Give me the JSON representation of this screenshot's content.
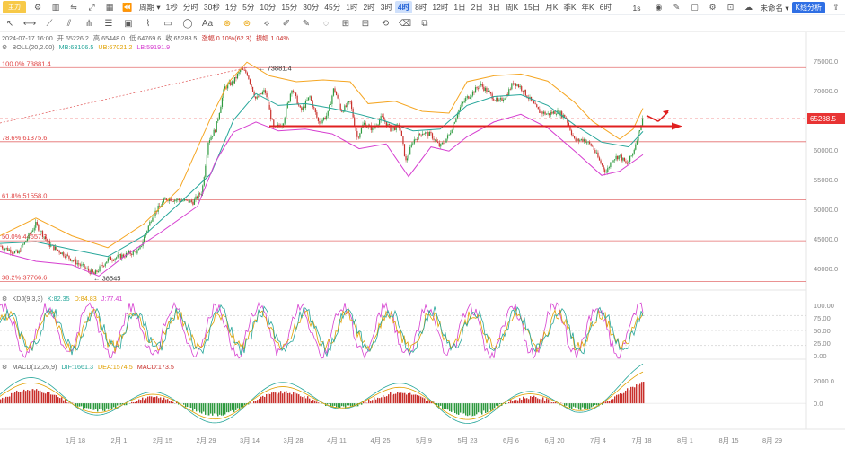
{
  "toolbar": {
    "badge": "主力",
    "period_label": "周期",
    "intervals": [
      "1秒",
      "分时",
      "30秒",
      "1分",
      "5分",
      "10分",
      "15分",
      "30分",
      "45分",
      "1时",
      "2时",
      "3时",
      "4时",
      "8时",
      "12时",
      "1日",
      "2日",
      "3日",
      "周K",
      "15日",
      "月K",
      "季K",
      "年K",
      "6时"
    ],
    "active_interval": "4时",
    "right_value": "1s",
    "template_label": "未命名",
    "kline_button": "K线分析"
  },
  "info": {
    "date": "2024-07-17 16:00",
    "open": "开 65226.2",
    "high": "高 65448.0",
    "low": "低 64769.6",
    "close": "收 65288.5",
    "change": "涨幅 0.10%(62.3)",
    "amplitude": "振幅 1.04%",
    "boll_label": "BOLL(20,2.00)",
    "boll_mb": "MB:63106.5",
    "boll_ub": "UB:67021.2",
    "boll_lb": "LB:59191.9",
    "kdj_label": "KDJ(9,3,3)",
    "kdj_k": "K:82.35",
    "kdj_d": "D:84.83",
    "kdj_j": "J:77.41",
    "macd_label": "MACD(12,26,9)",
    "macd_dif": "DIF:1661.3",
    "macd_dea": "DEA:1574.5",
    "macd_val": "MACD:173.5"
  },
  "fib_levels": [
    {
      "label": "100.0% 73881.4",
      "value": 73881.4
    },
    {
      "label": "78.6% 61375.6",
      "value": 61375.6
    },
    {
      "label": "61.8% 51558.0",
      "value": 51558.0
    },
    {
      "label": "50.0% 44657.3",
      "value": 44657.3
    },
    {
      "label": "38.2% 37766.6",
      "value": 37766.6
    }
  ],
  "annotations": {
    "high_label": "73881.4",
    "low_label": "38545",
    "current_price": "65288.5"
  },
  "colors": {
    "up": "#2e9a3f",
    "down": "#c9302c",
    "boll_mb": "#26a69a",
    "boll_ub": "#f5a623",
    "boll_lb": "#d63fd0",
    "fib": "#e05555",
    "arrow": "#e02020",
    "price_tag": "#e83333",
    "kdj_k": "#26a69a",
    "kdj_d": "#e0a000",
    "kdj_j": "#d63fd0",
    "macd_dif": "#26a69a",
    "macd_dea": "#e0a000"
  },
  "chart_data": {
    "type": "candlestick",
    "price_axis": [
      "75000.0",
      "70000.0",
      "65000.0",
      "60000.0",
      "55000.0",
      "50000.0",
      "45000.0",
      "40000.0"
    ],
    "price_ylim": [
      36500,
      76500
    ],
    "kdj_axis": [
      "100.00",
      "75.00",
      "50.00",
      "25.00",
      "0.00"
    ],
    "macd_axis": [
      "2000.0",
      "0.0"
    ],
    "x_labels": [
      "1月 18",
      "2月 1",
      "2月 15",
      "2月 29",
      "3月 14",
      "3月 28",
      "4月 11",
      "4月 25",
      "5月 9",
      "5月 23",
      "6月 6",
      "6月 20",
      "7月 4",
      "7月 18",
      "8月 1",
      "8月 15",
      "8月 29"
    ],
    "close_path": [
      [
        0,
        43800
      ],
      [
        20,
        42500
      ],
      [
        40,
        47500
      ],
      [
        55,
        44000
      ],
      [
        70,
        42500
      ],
      [
        90,
        40500
      ],
      [
        105,
        39000
      ],
      [
        120,
        41500
      ],
      [
        140,
        42300
      ],
      [
        155,
        43000
      ],
      [
        170,
        49000
      ],
      [
        185,
        51800
      ],
      [
        200,
        51500
      ],
      [
        215,
        51200
      ],
      [
        225,
        53000
      ],
      [
        232,
        61500
      ],
      [
        240,
        63500
      ],
      [
        250,
        70500
      ],
      [
        260,
        71500
      ],
      [
        268,
        73500
      ],
      [
        275,
        73000
      ],
      [
        285,
        68500
      ],
      [
        295,
        70000
      ],
      [
        305,
        63500
      ],
      [
        315,
        64500
      ],
      [
        325,
        70500
      ],
      [
        335,
        66500
      ],
      [
        345,
        69000
      ],
      [
        355,
        64500
      ],
      [
        365,
        66000
      ],
      [
        372,
        70500
      ],
      [
        380,
        66500
      ],
      [
        390,
        68000
      ],
      [
        398,
        62000
      ],
      [
        405,
        64500
      ],
      [
        415,
        63500
      ],
      [
        425,
        65500
      ],
      [
        435,
        63500
      ],
      [
        445,
        64000
      ],
      [
        452,
        58000
      ],
      [
        460,
        61500
      ],
      [
        470,
        63000
      ],
      [
        480,
        62500
      ],
      [
        490,
        60500
      ],
      [
        500,
        62500
      ],
      [
        510,
        66500
      ],
      [
        518,
        68500
      ],
      [
        525,
        69500
      ],
      [
        535,
        71000
      ],
      [
        545,
        69500
      ],
      [
        555,
        68000
      ],
      [
        565,
        69500
      ],
      [
        572,
        71500
      ],
      [
        580,
        70500
      ],
      [
        590,
        68500
      ],
      [
        600,
        66500
      ],
      [
        610,
        66000
      ],
      [
        620,
        66500
      ],
      [
        630,
        65500
      ],
      [
        640,
        61500
      ],
      [
        650,
        61800
      ],
      [
        660,
        60500
      ],
      [
        668,
        58000
      ],
      [
        675,
        56200
      ],
      [
        682,
        58500
      ],
      [
        690,
        59000
      ],
      [
        698,
        57500
      ],
      [
        705,
        59500
      ],
      [
        712,
        63500
      ],
      [
        716,
        65288
      ]
    ],
    "bollinger": {
      "mb": [
        [
          0,
          44200
        ],
        [
          40,
          44500
        ],
        [
          80,
          43200
        ],
        [
          120,
          42000
        ],
        [
          160,
          45500
        ],
        [
          200,
          51000
        ],
        [
          235,
          56000
        ],
        [
          260,
          65000
        ],
        [
          285,
          69500
        ],
        [
          310,
          67500
        ],
        [
          340,
          67800
        ],
        [
          370,
          67000
        ],
        [
          400,
          66000
        ],
        [
          430,
          64800
        ],
        [
          460,
          63200
        ],
        [
          490,
          63500
        ],
        [
          520,
          67500
        ],
        [
          550,
          69000
        ],
        [
          580,
          69300
        ],
        [
          610,
          67500
        ],
        [
          640,
          64200
        ],
        [
          670,
          61300
        ],
        [
          700,
          60500
        ],
        [
          716,
          63106
        ]
      ],
      "ub": [
        [
          0,
          45500
        ],
        [
          40,
          48500
        ],
        [
          80,
          45500
        ],
        [
          120,
          43500
        ],
        [
          160,
          47500
        ],
        [
          200,
          53500
        ],
        [
          235,
          65500
        ],
        [
          255,
          71500
        ],
        [
          275,
          74800
        ],
        [
          300,
          72500
        ],
        [
          330,
          71500
        ],
        [
          360,
          71800
        ],
        [
          390,
          71500
        ],
        [
          410,
          67800
        ],
        [
          440,
          68200
        ],
        [
          470,
          66500
        ],
        [
          500,
          66200
        ],
        [
          520,
          71500
        ],
        [
          550,
          72500
        ],
        [
          580,
          72800
        ],
        [
          610,
          71600
        ],
        [
          640,
          68000
        ],
        [
          660,
          64800
        ],
        [
          690,
          61800
        ],
        [
          705,
          63500
        ],
        [
          716,
          67021
        ]
      ],
      "lb": [
        [
          0,
          42800
        ],
        [
          40,
          41200
        ],
        [
          80,
          40600
        ],
        [
          110,
          38700
        ],
        [
          140,
          42200
        ],
        [
          180,
          46200
        ],
        [
          220,
          50500
        ],
        [
          240,
          58000
        ],
        [
          260,
          63000
        ],
        [
          285,
          64700
        ],
        [
          310,
          63200
        ],
        [
          340,
          63500
        ],
        [
          370,
          62700
        ],
        [
          400,
          60200
        ],
        [
          430,
          61000
        ],
        [
          455,
          55500
        ],
        [
          480,
          60500
        ],
        [
          500,
          59800
        ],
        [
          520,
          62200
        ],
        [
          550,
          64700
        ],
        [
          580,
          66000
        ],
        [
          610,
          63700
        ],
        [
          640,
          59800
        ],
        [
          670,
          55700
        ],
        [
          690,
          56400
        ],
        [
          716,
          59191
        ]
      ]
    },
    "kdj_latest": {
      "K": 82.35,
      "D": 84.83,
      "J": 77.41
    },
    "macd_latest": {
      "DIF": 1661.3,
      "DEA": 1574.5,
      "MACD": 173.5
    }
  }
}
